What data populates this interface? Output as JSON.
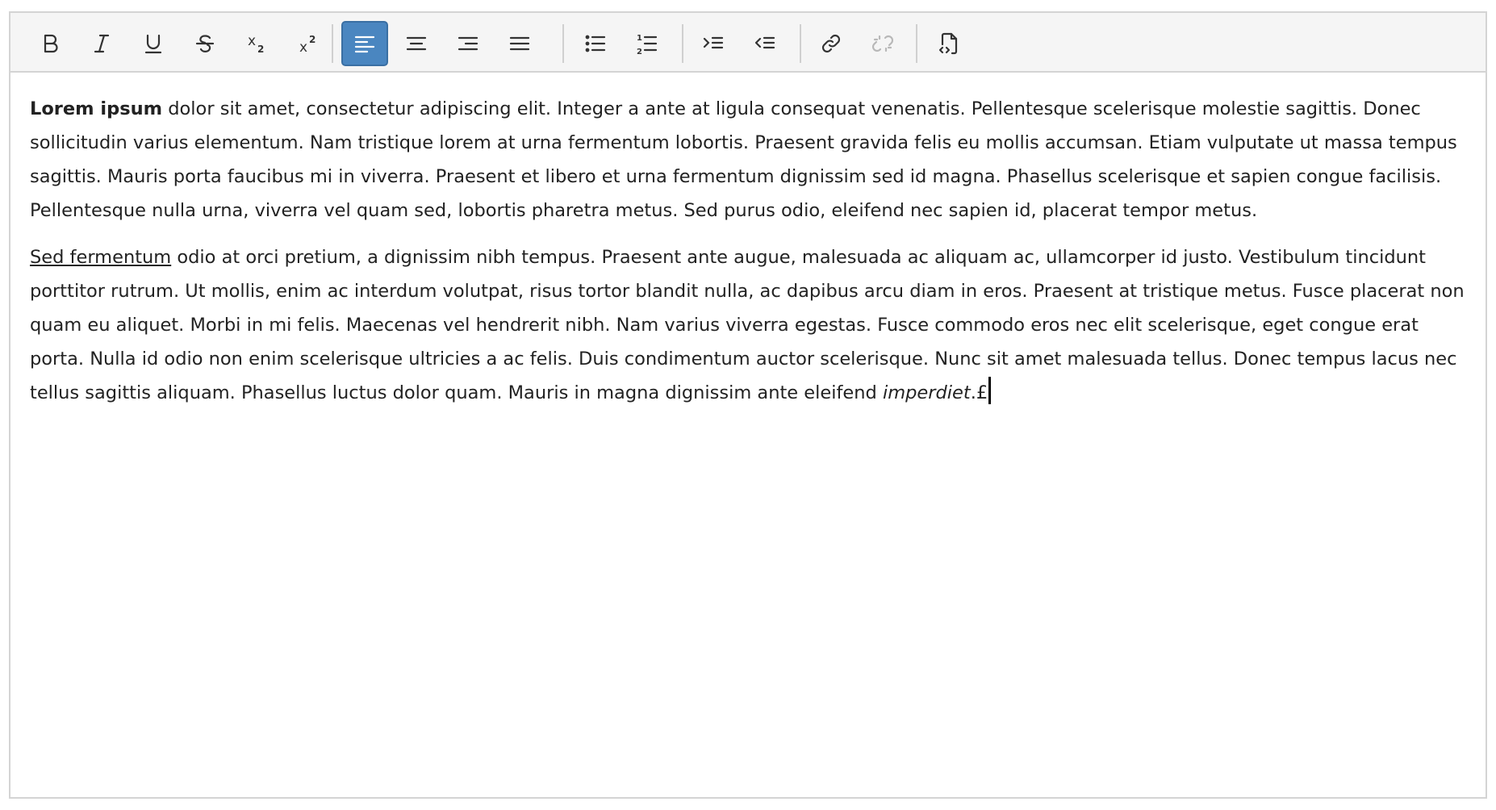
{
  "toolbar": {
    "buttons": [
      {
        "name": "bold-button",
        "icon": "bold-icon",
        "state": "normal"
      },
      {
        "name": "italic-button",
        "icon": "italic-icon",
        "state": "normal"
      },
      {
        "name": "underline-button",
        "icon": "underline-icon",
        "state": "normal"
      },
      {
        "name": "strikethrough-button",
        "icon": "strikethrough-icon",
        "state": "normal"
      },
      {
        "name": "subscript-button",
        "icon": "subscript-icon",
        "state": "normal"
      },
      {
        "name": "superscript-button",
        "icon": "superscript-icon",
        "state": "normal"
      },
      {
        "name": "align-left-button",
        "icon": "align-left-icon",
        "state": "active"
      },
      {
        "name": "align-center-button",
        "icon": "align-center-icon",
        "state": "normal"
      },
      {
        "name": "align-right-button",
        "icon": "align-right-icon",
        "state": "normal"
      },
      {
        "name": "align-justify-button",
        "icon": "align-justify-icon",
        "state": "normal"
      },
      {
        "name": "bullet-list-button",
        "icon": "bullet-list-icon",
        "state": "normal"
      },
      {
        "name": "numbered-list-button",
        "icon": "numbered-list-icon",
        "state": "normal"
      },
      {
        "name": "indent-button",
        "icon": "indent-icon",
        "state": "normal"
      },
      {
        "name": "outdent-button",
        "icon": "outdent-icon",
        "state": "normal"
      },
      {
        "name": "link-button",
        "icon": "link-icon",
        "state": "normal"
      },
      {
        "name": "unlink-button",
        "icon": "unlink-icon",
        "state": "disabled"
      },
      {
        "name": "source-code-button",
        "icon": "file-code-icon",
        "state": "normal"
      }
    ],
    "sub_glyph": "x",
    "sub_digit": "2",
    "sup_glyph": "x",
    "sup_digit": "2",
    "list_num_1": "1",
    "list_num_2": "2"
  },
  "colors": {
    "active_button_bg": "#4a86c0",
    "toolbar_bg": "#f5f5f5",
    "border": "#d4d4d4",
    "text": "#222222"
  },
  "content": {
    "p1": {
      "bold": "Lorem ipsum",
      "text": " dolor sit amet, consectetur adipiscing elit. Integer a ante at ligula consequat venenatis. Pellentesque scelerisque molestie sagittis. Donec sollicitudin varius elementum. Nam tristique lorem at urna fermentum lobortis. Praesent gravida felis eu mollis accumsan. Etiam vulputate ut massa tempus sagittis. Mauris porta faucibus mi in viverra. Praesent et libero et urna fermentum dignissim sed id magna. Phasellus scelerisque et sapien congue facilisis. Pellentesque nulla urna, viverra vel quam sed, lobortis pharetra metus. Sed purus odio, eleifend nec sapien id, placerat tempor metus."
    },
    "p2": {
      "underline": "Sed fermentum",
      "text": " odio at orci pretium, a dignissim nibh tempus. Praesent ante augue, malesuada ac aliquam ac, ullamcorper id justo. Vestibulum tincidunt porttitor rutrum. Ut mollis, enim ac interdum volutpat, risus tortor blandit nulla, ac dapibus arcu diam in eros. Praesent at tristique metus. Fusce placerat non quam eu aliquet. Morbi in mi felis. Maecenas vel hendrerit nibh. Nam varius viverra egestas. Fusce commodo eros nec elit scelerisque, eget congue erat porta. Nulla id odio non enim scelerisque ultricies a ac felis. Duis condimentum auctor scelerisque. Nunc sit amet malesuada tellus. Donec tempus lacus nec tellus sagittis aliquam. Phasellus luctus dolor quam. Mauris in magna dignissim ante eleifend ",
      "italic": "imperdiet",
      "tail": ".£"
    }
  }
}
